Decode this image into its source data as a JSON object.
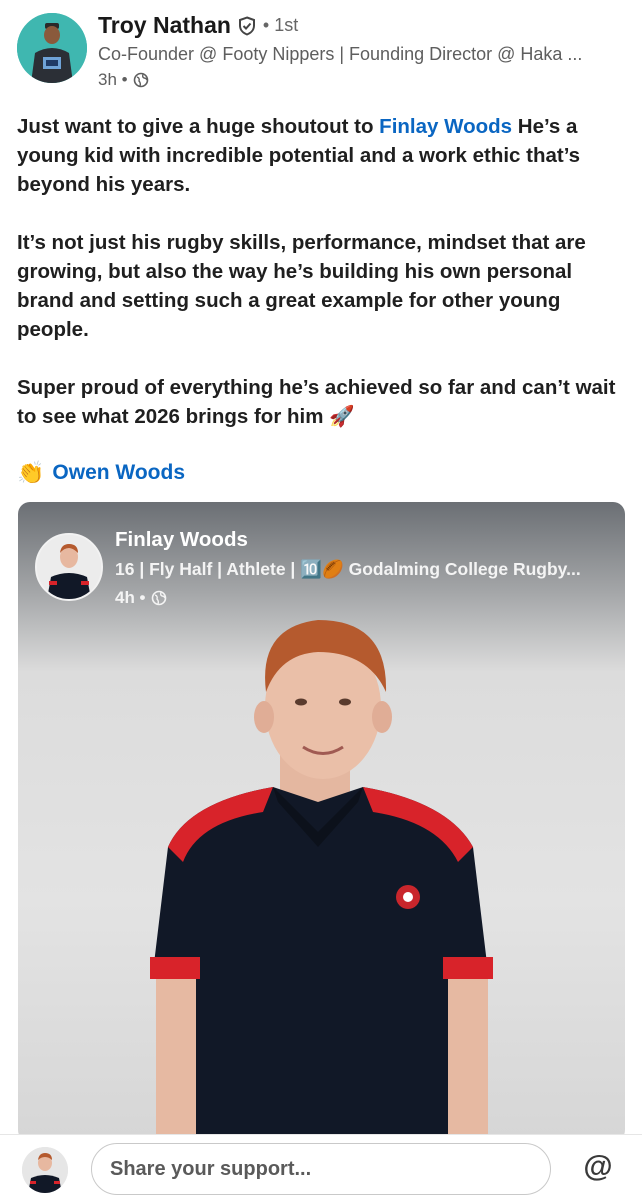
{
  "post": {
    "author": {
      "name": "Troy Nathan",
      "degree": "• 1st",
      "headline": "Co-Founder @ Footy Nippers | Founding Director @ Haka ...",
      "time": "3h •"
    },
    "text": {
      "p1_before": "Just want to give a huge shoutout to ",
      "p1_mention": "Finlay Woods",
      "p1_after": "  He’s a young kid with incredible potential and a work ethic that’s beyond his years.",
      "p2": "It’s not just his rugby skills, performance, mindset that are growing, but also the way he’s building his own personal brand and setting such a great example for other young people.",
      "p3": "Super proud of everything he’s achieved so far and can’t wait to see what 2026 brings for him 🚀"
    },
    "mention": {
      "emoji": "👏",
      "name": "Owen Woods"
    }
  },
  "shared_card": {
    "name": "Finlay Woods",
    "headline": "16 | Fly Half | Athlete | 🔟🏉 Godalming College Rugby...",
    "time": "4h •"
  },
  "composer": {
    "placeholder": "Share your support...",
    "mention_button": "@"
  },
  "icons": {
    "verified": "shield-check-icon",
    "globe": "globe-icon"
  },
  "colors": {
    "link": "#0a66c2",
    "avatar_bg": "#3fb7b0"
  }
}
